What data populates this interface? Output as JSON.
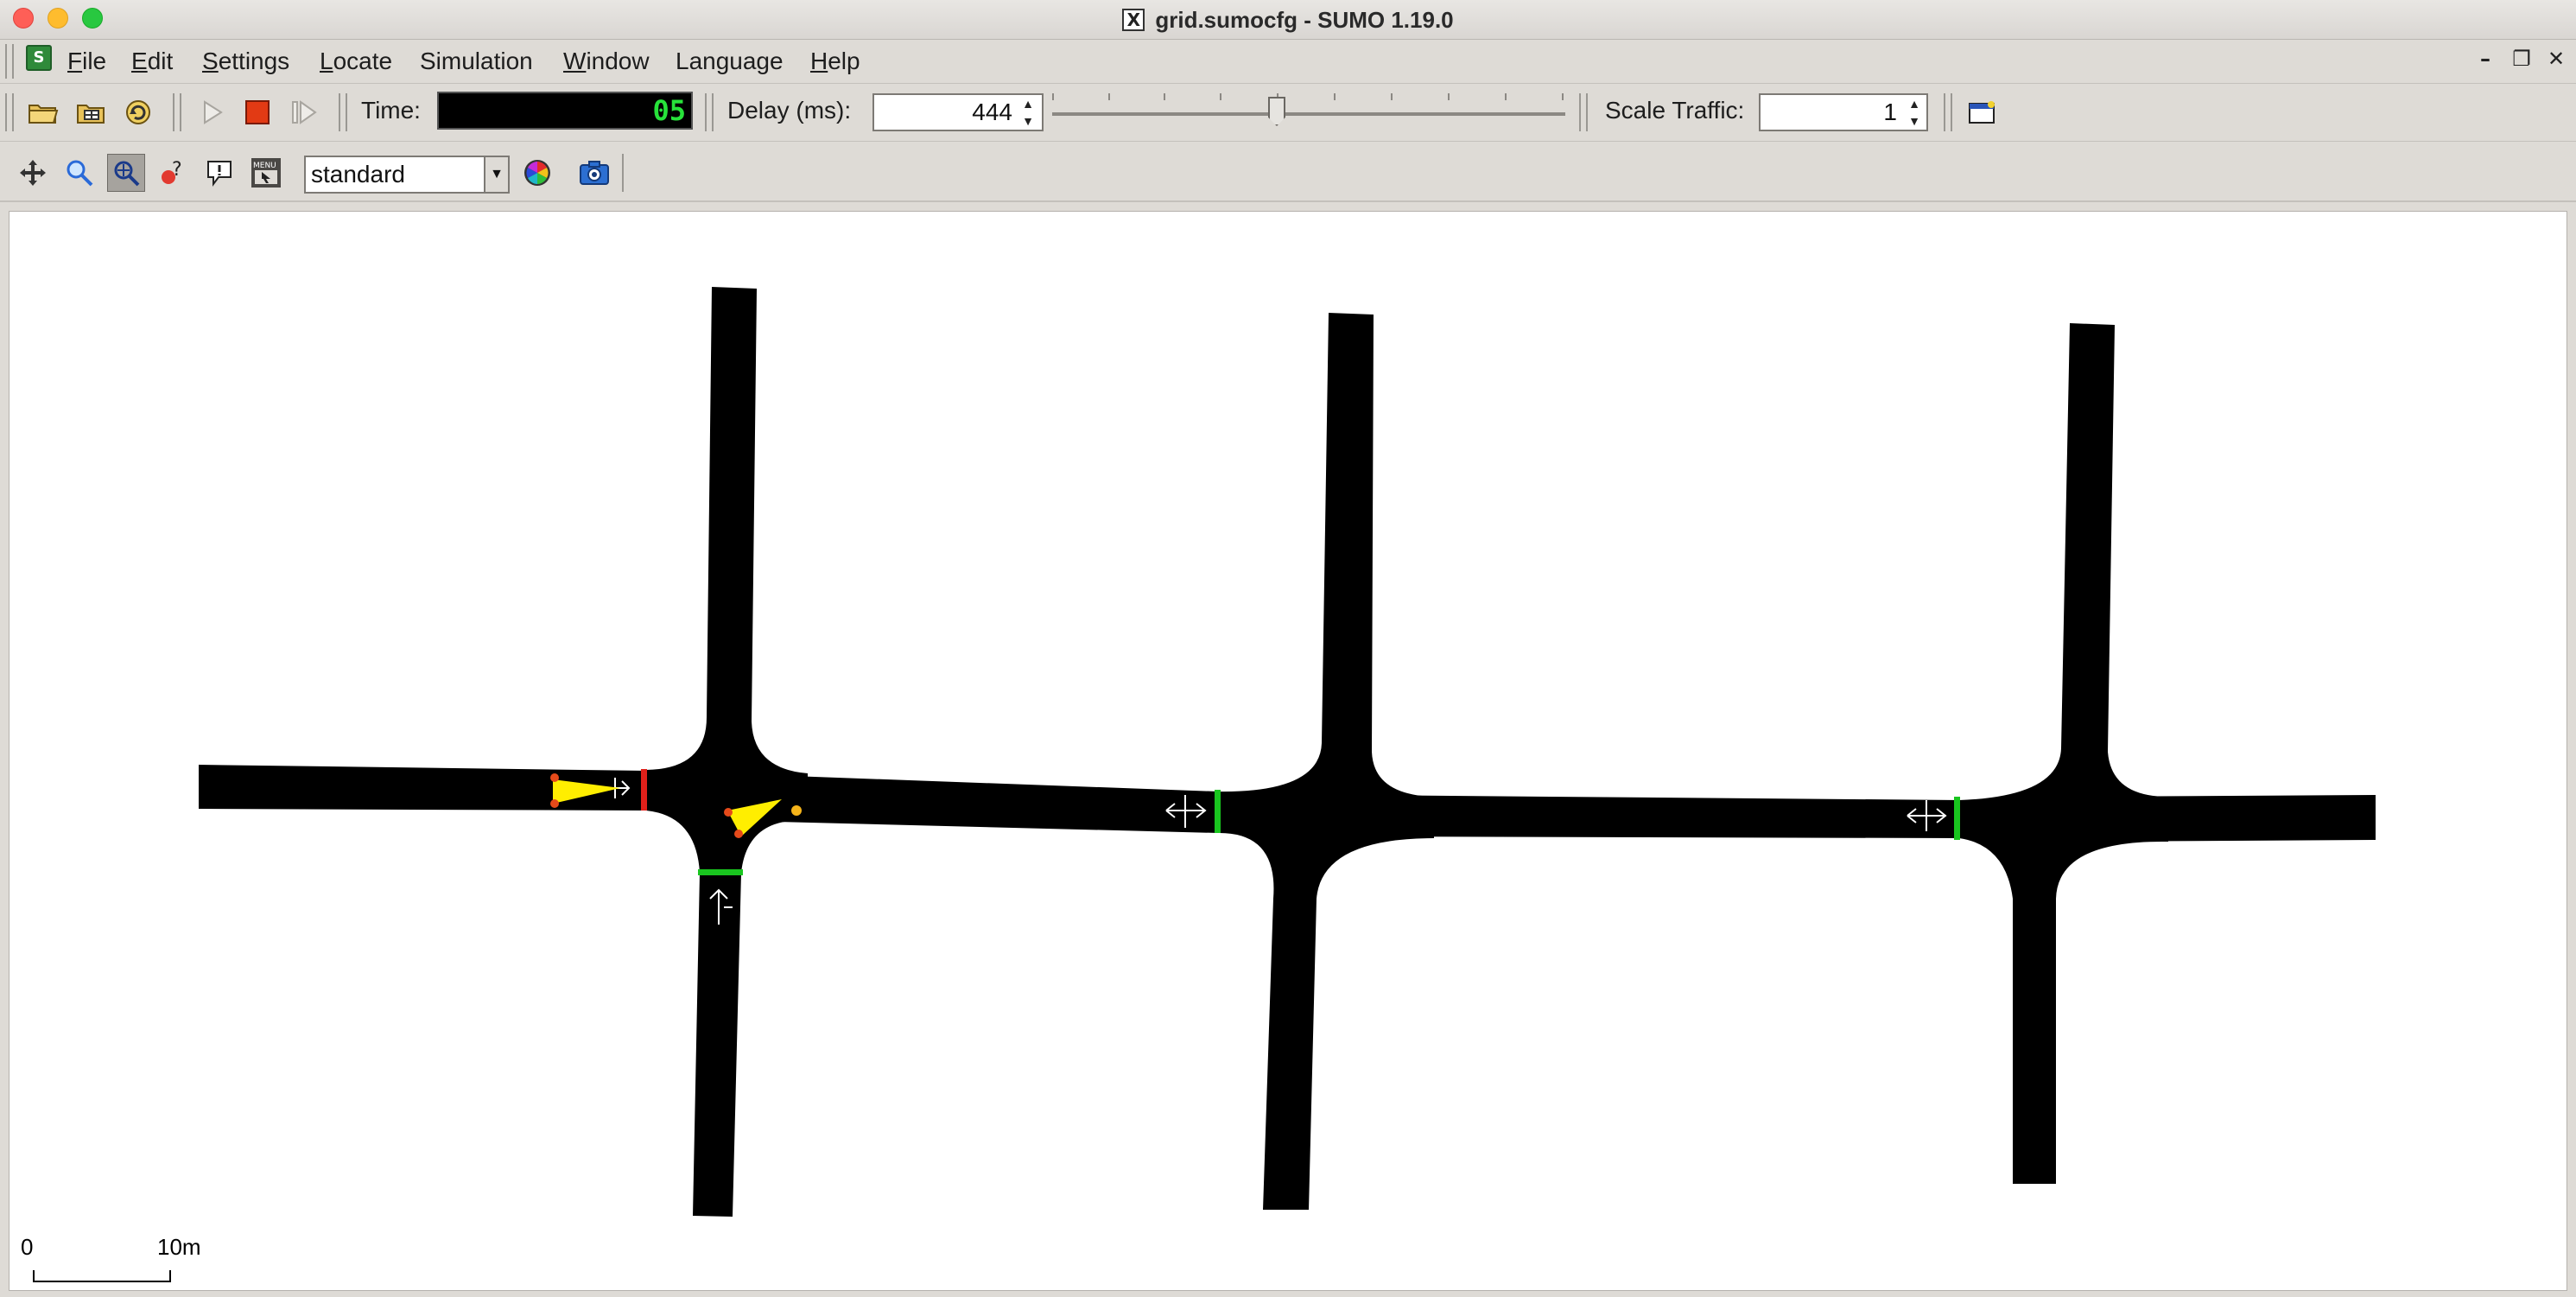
{
  "window": {
    "title": "grid.sumocfg - SUMO 1.19.0",
    "x_icon_glyph": "X"
  },
  "menu": {
    "items": [
      {
        "u": "F",
        "rest": "ile"
      },
      {
        "u": "E",
        "rest": "dit"
      },
      {
        "u": "S",
        "rest": "ettings"
      },
      {
        "u": "L",
        "rest": "ocate"
      },
      {
        "u": "",
        "rest": "Simulation"
      },
      {
        "u": "W",
        "rest": "indow"
      },
      {
        "u": "",
        "rest": "Language"
      },
      {
        "u": "H",
        "rest": "elp"
      }
    ]
  },
  "toolbar": {
    "time_label": "Time:",
    "time_value": "05",
    "delay_label": "Delay (ms):",
    "delay_value": "444",
    "delay_slider_fraction": 0.44,
    "scale_traffic_label": "Scale Traffic:",
    "scale_traffic_value": "1"
  },
  "view_toolbar": {
    "color_scheme": "standard"
  },
  "canvas": {
    "scale_start": "0",
    "scale_end": "10m",
    "colors": {
      "road": "#000000",
      "signal_red": "#e0201a",
      "signal_green": "#19c51f",
      "vehicle": "#ffee00"
    }
  }
}
